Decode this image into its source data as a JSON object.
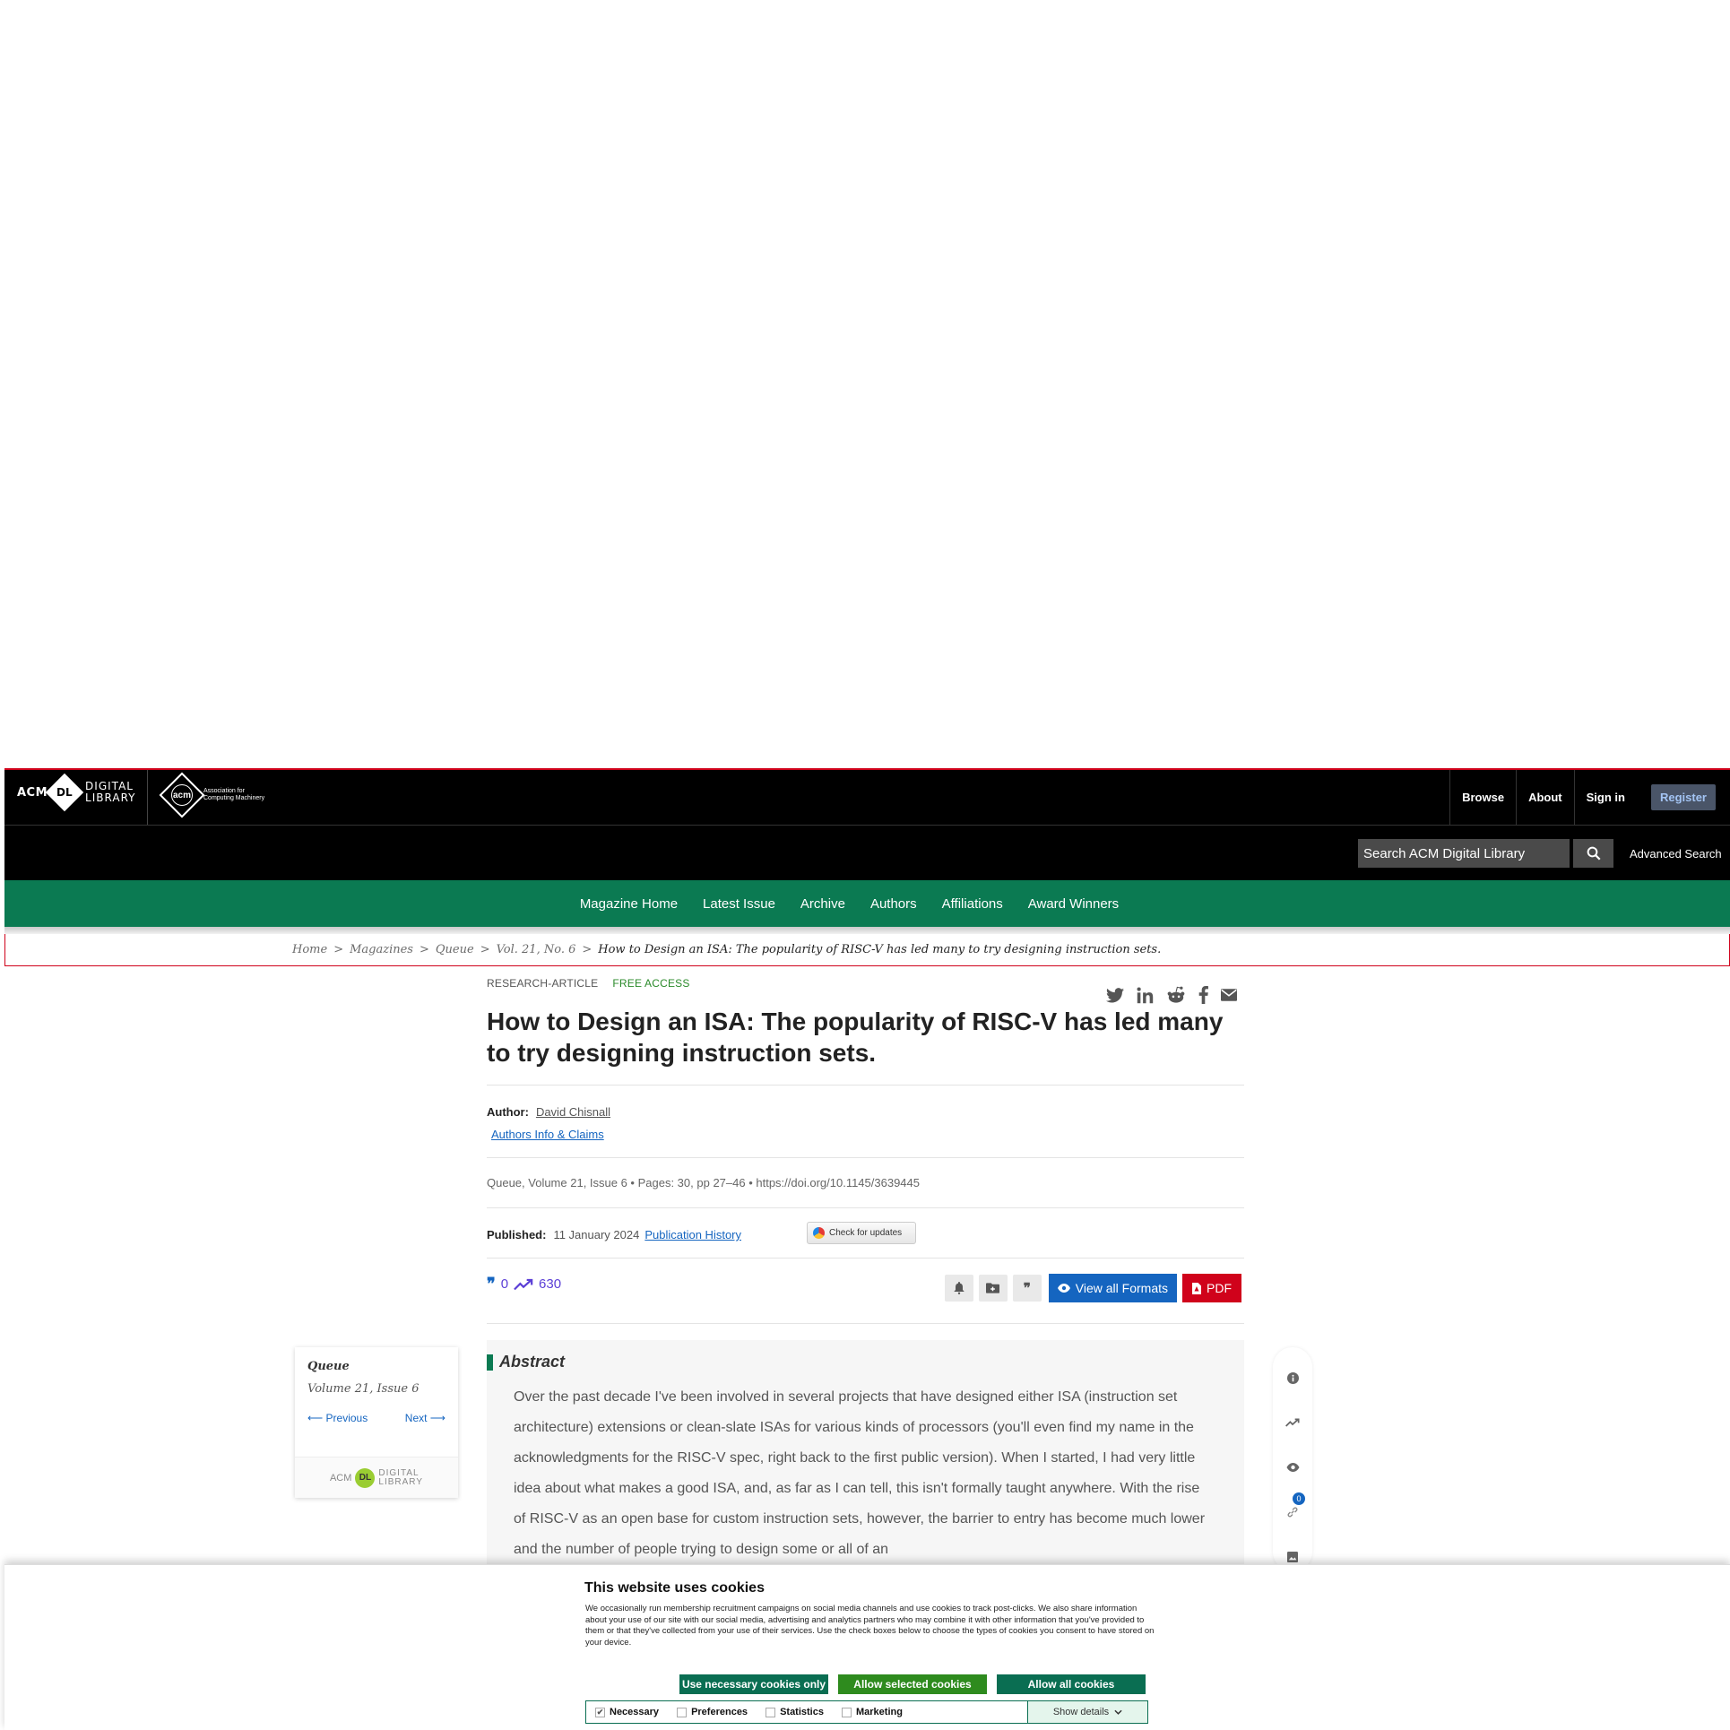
{
  "header": {
    "logo_acm": "ACM",
    "logo_dl": "DL",
    "logo_digital": "DIGITAL",
    "logo_library": "LIBRARY",
    "org_seal": "acm",
    "org_line1": "Association for",
    "org_line2": "Computing Machinery",
    "links": [
      "Browse",
      "About",
      "Sign in"
    ],
    "register": "Register",
    "search_placeholder": "Search ACM Digital Library",
    "advanced_search": "Advanced Search"
  },
  "nav": [
    "Magazine Home",
    "Latest Issue",
    "Archive",
    "Authors",
    "Affiliations",
    "Award Winners"
  ],
  "breadcrumb": {
    "items": [
      "Home",
      "Magazines",
      "Queue",
      "Vol. 21, No. 6"
    ],
    "current": "How to Design an ISA: The popularity of RISC-V has led many to try designing instruction sets."
  },
  "article": {
    "type": "RESEARCH-ARTICLE",
    "access": "FREE ACCESS",
    "title": "How to Design an ISA: The popularity of RISC-V has led many to try designing instruction sets.",
    "author_label": "Author:",
    "author_name": "David Chisnall",
    "authors_info": "Authors Info & Claims",
    "meta_line": "Queue, Volume 21, Issue 6 • Pages: 30, pp 27–46 • https://doi.org/10.1145/3639445",
    "published_label": "Published:",
    "published_date": "11 January 2024",
    "pub_history": "Publication History",
    "check_updates": "Check for updates",
    "citations": "0",
    "downloads": "630",
    "view_formats": "View all Formats",
    "pdf": "PDF",
    "abstract_heading": "Abstract",
    "abstract_text": "Over the past decade I've been involved in several projects that have designed either ISA (instruction set architecture) extensions or clean-slate ISAs for various kinds of processors (you'll even find my name in the acknowledgments for the RISC-V spec, right back to the first public version). When I started, I had very little idea about what makes a good ISA, and, as far as I can tell, this isn't formally taught anywhere. With the rise of RISC-V as an open base for custom instruction sets, however, the barrier to entry has become much lower and the number of people trying to design some or all of an"
  },
  "issue_card": {
    "title": "Queue",
    "volume": "Volume 21, Issue 6",
    "previous": "⟵ Previous",
    "next": "Next ⟶",
    "footer_acm": "ACM",
    "footer_dl": "DL",
    "footer_digital": "DIGITAL",
    "footer_library": "LIBRARY"
  },
  "rail": {
    "badge": "0"
  },
  "cookie": {
    "title": "This website uses cookies",
    "text": "We occasionally run membership recruitment campaigns on social media channels and use cookies to track post-clicks. We also share information about your use of our site with our social media, advertising and analytics partners who may combine it with other information that you've provided to them or that they've collected from your use of their services. Use the check boxes below to choose the types of cookies you consent to have stored on your device.",
    "btn_necessary": "Use necessary cookies only",
    "btn_selected": "Allow selected cookies",
    "btn_all": "Allow all cookies",
    "opt_necessary": "Necessary",
    "opt_preferences": "Preferences",
    "opt_statistics": "Statistics",
    "opt_marketing": "Marketing",
    "show_details": "Show details"
  },
  "colors": {
    "nav_green": "#0b7a52",
    "accent_blue": "#1565c0",
    "pdf_red": "#d0021b",
    "cookie_green": "#0a6e52"
  }
}
